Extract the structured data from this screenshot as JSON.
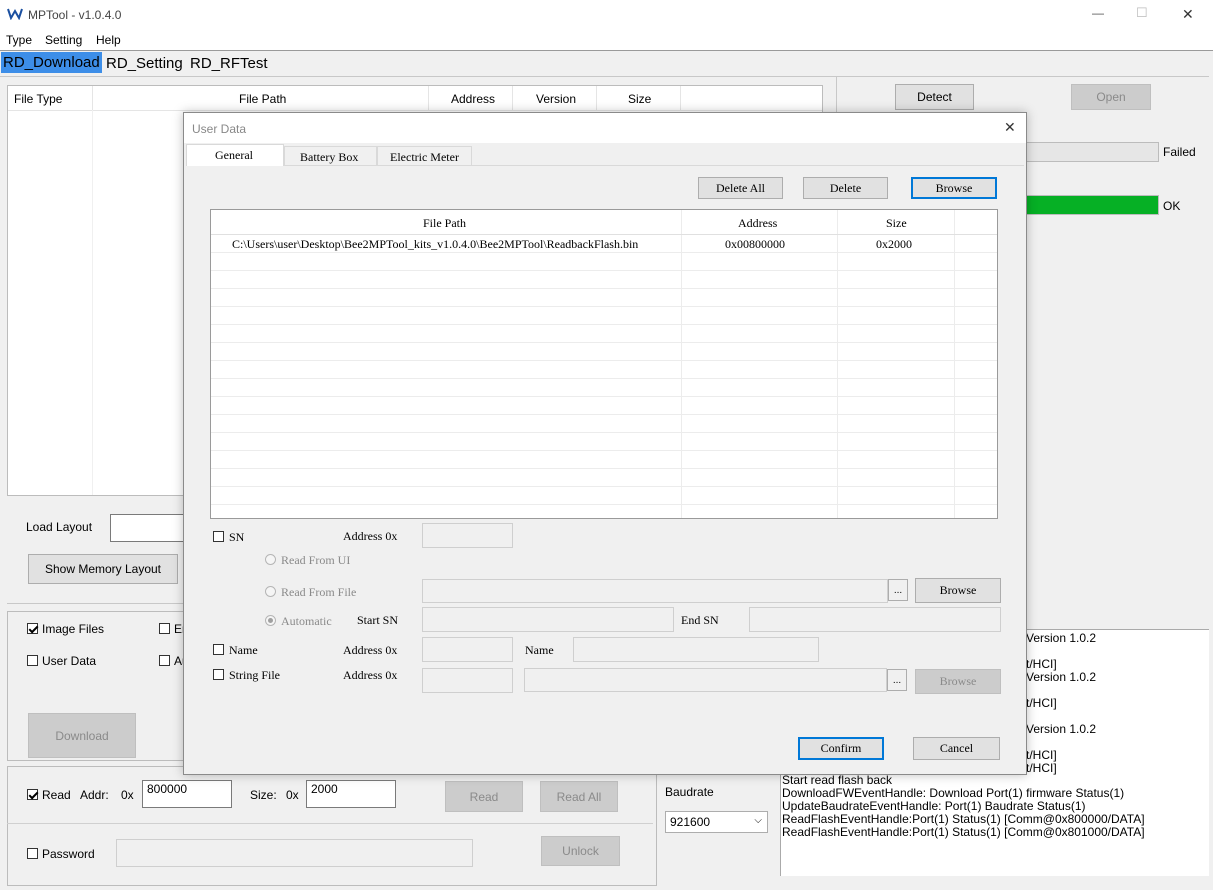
{
  "window": {
    "title": "MPTool - v1.0.4.0",
    "controls": {
      "minimize": "—",
      "maximize": "☐",
      "close": "✕"
    }
  },
  "menu": [
    "Type",
    "Setting",
    "Help"
  ],
  "tabs": [
    "RD_Download",
    "RD_Setting",
    "RD_RFTest"
  ],
  "file_table": {
    "headers": [
      "File Type",
      "File Path",
      "Address",
      "Version",
      "Size"
    ]
  },
  "right_panel": {
    "detect_label": "Detect",
    "open_label": "Open",
    "failed_label": "Failed",
    "ok_label": "OK",
    "ok_progress": 1.0
  },
  "layout": {
    "load_layout_label": "Load Layout",
    "show_memory_label": "Show Memory Layout"
  },
  "options": {
    "image_files_label": "Image Files",
    "user_data_label": "User Data",
    "en_label": "Er",
    "au_label": "Au",
    "download_label": "Download"
  },
  "read_section": {
    "read_label": "Read",
    "addr_label": "Addr:",
    "addr_prefix": "0x",
    "addr_value": "800000",
    "size_label": "Size:",
    "size_prefix": "0x",
    "size_value": "2000",
    "read_btn": "Read",
    "read_all_btn": "Read All",
    "password_label": "Password",
    "unlock_btn": "Unlock"
  },
  "baudrate": {
    "label": "Baudrate",
    "value": "921600"
  },
  "log": {
    "partial_lines": [
      "Version 1.0.2",
      "t/HCI]",
      "Version 1.0.2",
      "t/HCI]",
      "Version 1.0.2",
      "t/HCI]",
      "t/HCI]"
    ],
    "lines": [
      "Start read flash back",
      "DownloadFWEventHandle: Download Port(1) firmware Status(1)",
      "UpdateBaudrateEventHandle: Port(1) Baudrate Status(1)",
      "ReadFlashEventHandle:Port(1) Status(1) [Comm@0x800000/DATA]",
      "ReadFlashEventHandle:Port(1) Status(1) [Comm@0x801000/DATA]"
    ]
  },
  "dialog": {
    "title": "User Data",
    "close": "✕",
    "tabs": [
      "General",
      "Battery Box",
      "Electric Meter"
    ],
    "delete_all": "Delete All",
    "delete": "Delete",
    "browse": "Browse",
    "table": {
      "headers": [
        "File Path",
        "Address",
        "Size"
      ],
      "rows": [
        {
          "path": "C:\\Users\\user\\Desktop\\Bee2MPTool_kits_v1.0.4.0\\Bee2MPTool\\ReadbackFlash.bin",
          "address": "0x00800000",
          "size": "0x2000"
        }
      ]
    },
    "sn_label": "SN",
    "address_label": "Address 0x",
    "read_from_ui": "Read From UI",
    "read_from_file": "Read From File",
    "ellipsis": "...",
    "browse_sn": "Browse",
    "automatic": "Automatic",
    "start_sn": "Start SN",
    "end_sn": "End SN",
    "name_label": "Name",
    "name_address_label": "Address 0x",
    "name_field_label": "Name",
    "string_file_label": "String File",
    "string_address_label": "Address 0x",
    "browse_string": "Browse",
    "confirm": "Confirm",
    "cancel": "Cancel"
  }
}
